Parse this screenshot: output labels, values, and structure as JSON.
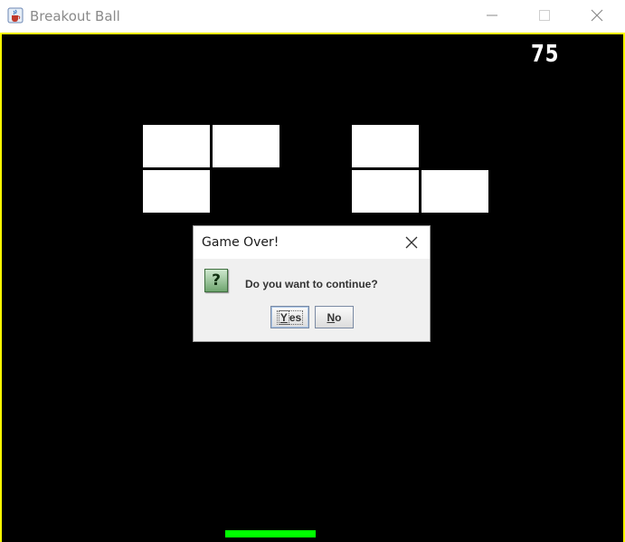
{
  "window": {
    "title": "Breakout Ball",
    "icon": "java-cup-icon",
    "controls": [
      "minimize-icon",
      "maximize-icon",
      "close-icon"
    ]
  },
  "game": {
    "score": "75",
    "border_color": "#ffff00",
    "background_color": "#000000",
    "brick_color": "#ffffff",
    "paddle_color": "#00ff00"
  },
  "dialog": {
    "title": "Game Over!",
    "message": "Do you want to continue?",
    "icon": "question-icon",
    "yes_mnemonic": "Y",
    "yes_rest": "es",
    "no_mnemonic": "N",
    "no_rest": "o"
  }
}
